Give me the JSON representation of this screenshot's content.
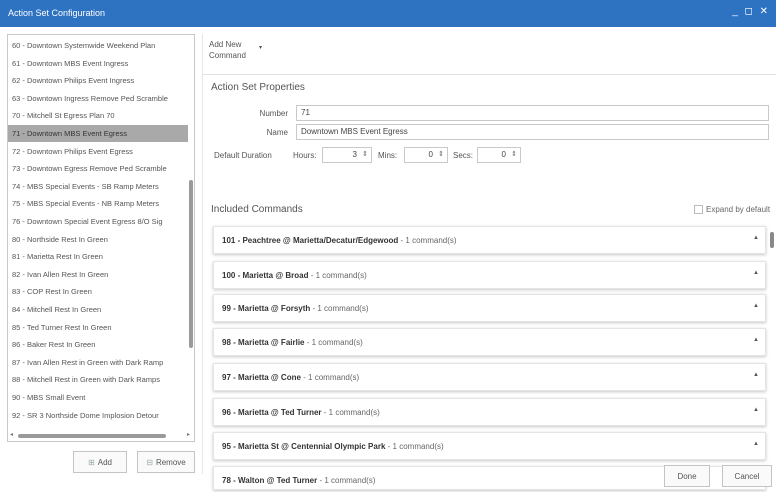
{
  "window": {
    "title": "Action Set Configuration",
    "controls": "_ ◻ ✕"
  },
  "action_sets": [
    "60 - Downtown Systemwide Weekend Plan",
    "61 - Downtown MBS Event Ingress",
    "62 - Downtown Philips Event Ingress",
    "63 - Downtown Ingress Remove Ped Scramble",
    "70 - Mitchell St Egress Plan 70",
    "71 - Downtown MBS Event Egress",
    "72 - Downtown Philips Event Egress",
    "73 - Downtown Egress Remove Ped Scramble",
    "74 - MBS Special Events - SB Ramp Meters",
    "75 - MBS Special Events - NB Ramp Meters",
    "76 - Downtown Special Event Egress 8/O Sig",
    "80 - Northside Rest In Green",
    "81 - Marietta Rest In Green",
    "82 - Ivan Allen Rest In Green",
    "83 - COP Rest In Green",
    "84 - Mitchell Rest In Green",
    "85 - Ted Turner Rest In Green",
    "86 - Baker Rest In Green",
    "87 - Ivan Allen Rest in Green with Dark Ramp",
    "88 - Mitchell Rest in Green with Dark Ramps",
    "90 - MBS Small Event",
    "92 - SR 3 Northside Dome Implosion Detour"
  ],
  "selected_index": 5,
  "left_buttons": {
    "add": "Add",
    "remove": "Remove"
  },
  "toolbar": {
    "add_new_line1": "Add New",
    "add_new_line2": "Command",
    "caret": "▾"
  },
  "properties": {
    "section_title": "Action Set Properties",
    "number_label": "Number",
    "number_value": "71",
    "name_label": "Name",
    "name_value": "Downtown MBS Event Egress",
    "duration_label": "Default Duration",
    "hours_label": "Hours:",
    "hours_value": "3",
    "mins_label": "Mins:",
    "mins_value": "0",
    "secs_label": "Secs:",
    "secs_value": "0"
  },
  "included": {
    "section_title": "Included Commands",
    "expand_label": "Expand by default",
    "commands": [
      {
        "name": "101 - Peachtree @ Marietta/Decatur/Edgewood",
        "count": "- 1 command(s)"
      },
      {
        "name": "100 - Marietta @ Broad",
        "count": "- 1 command(s)"
      },
      {
        "name": "99 - Marietta @ Forsyth",
        "count": "- 1 command(s)"
      },
      {
        "name": "98 - Marietta @ Fairlie",
        "count": "- 1 command(s)"
      },
      {
        "name": "97 - Marietta @ Cone",
        "count": "- 1 command(s)"
      },
      {
        "name": "96 - Marietta @ Ted Turner",
        "count": "- 1 command(s)"
      },
      {
        "name": "95 - Marietta St @ Centennial Olympic Park",
        "count": "- 1 command(s)"
      },
      {
        "name": "78 - Walton @ Ted Turner",
        "count": "- 1 command(s)"
      }
    ]
  },
  "footer": {
    "done": "Done",
    "cancel": "Cancel"
  }
}
